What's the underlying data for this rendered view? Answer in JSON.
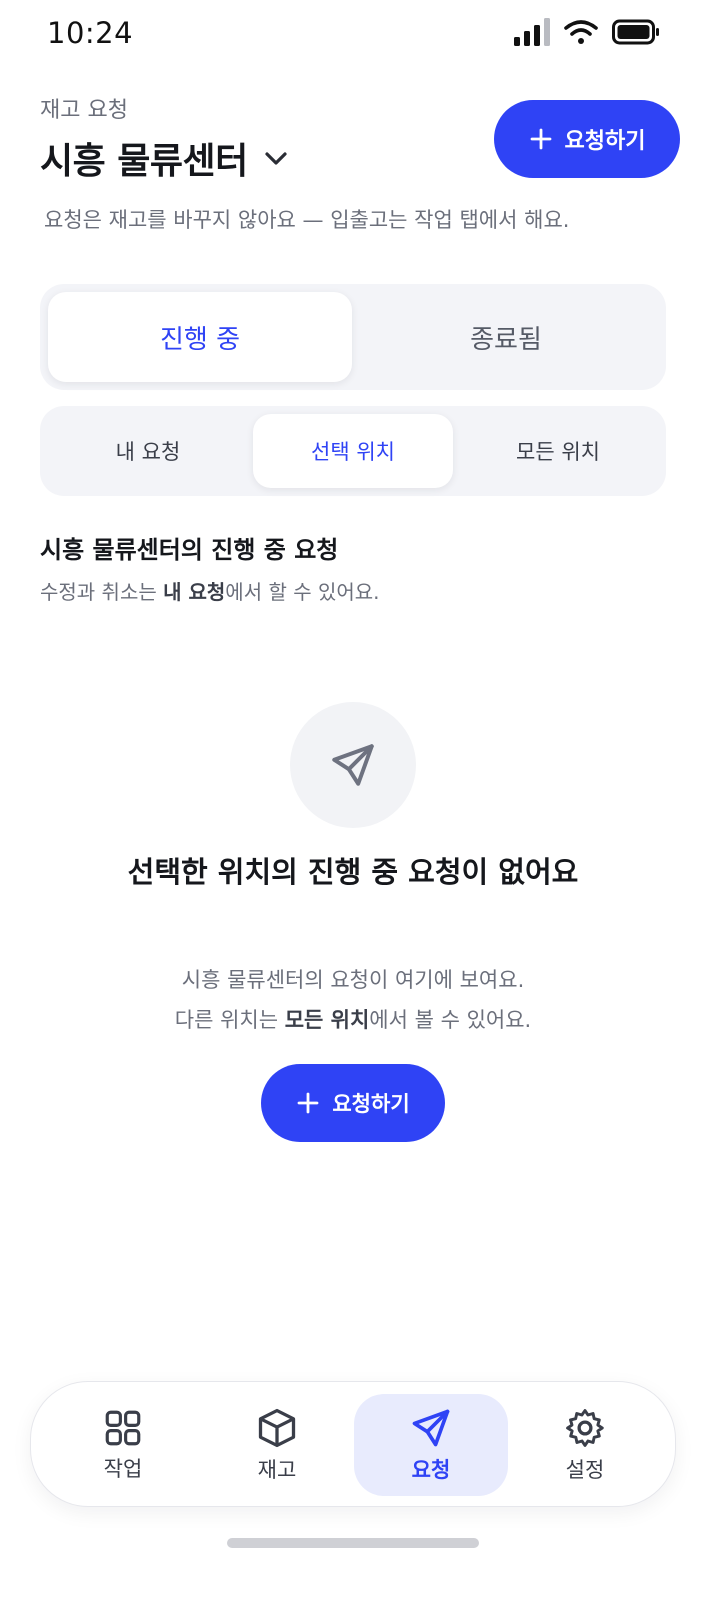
{
  "status": {
    "time": "10:24"
  },
  "header": {
    "eyebrow": "재고 요청",
    "location": "시흥 물류센터",
    "primary_button": "요청하기",
    "subtitle": "요청은 재고를 바꾸지 않아요 — 입출고는 작업 탭에서 해요."
  },
  "segments": [
    {
      "label": "진행 중",
      "active": true
    },
    {
      "label": "종료됨",
      "active": false
    }
  ],
  "scope": [
    {
      "label": "내 요청",
      "active": false
    },
    {
      "label": "선택 위치",
      "active": true
    },
    {
      "label": "모든 위치",
      "active": false
    }
  ],
  "section": {
    "title": "시흥 물류센터의 진행 중 요청",
    "note_prefix": "수정과 취소는 ",
    "note_bold": "내 요청",
    "note_suffix": "에서 할 수 있어요."
  },
  "empty": {
    "title": "선택한 위치의 진행 중 요청이 없어요",
    "line1": "시흥 물류센터의 요청이 여기에 보여요.",
    "line2_prefix": "다른 위치는 ",
    "line2_bold": "모든 위치",
    "line2_suffix": "에서 볼 수 있어요.",
    "button": "요청하기"
  },
  "tabs": [
    {
      "label": "작업",
      "icon": "grid-icon",
      "active": false
    },
    {
      "label": "재고",
      "icon": "box-icon",
      "active": false
    },
    {
      "label": "요청",
      "icon": "send-icon",
      "active": true
    },
    {
      "label": "설정",
      "icon": "gear-icon",
      "active": false
    }
  ],
  "colors": {
    "accent": "#2f43f5",
    "accent_soft": "#e8ebfd",
    "muted": "#6b6f7b"
  }
}
